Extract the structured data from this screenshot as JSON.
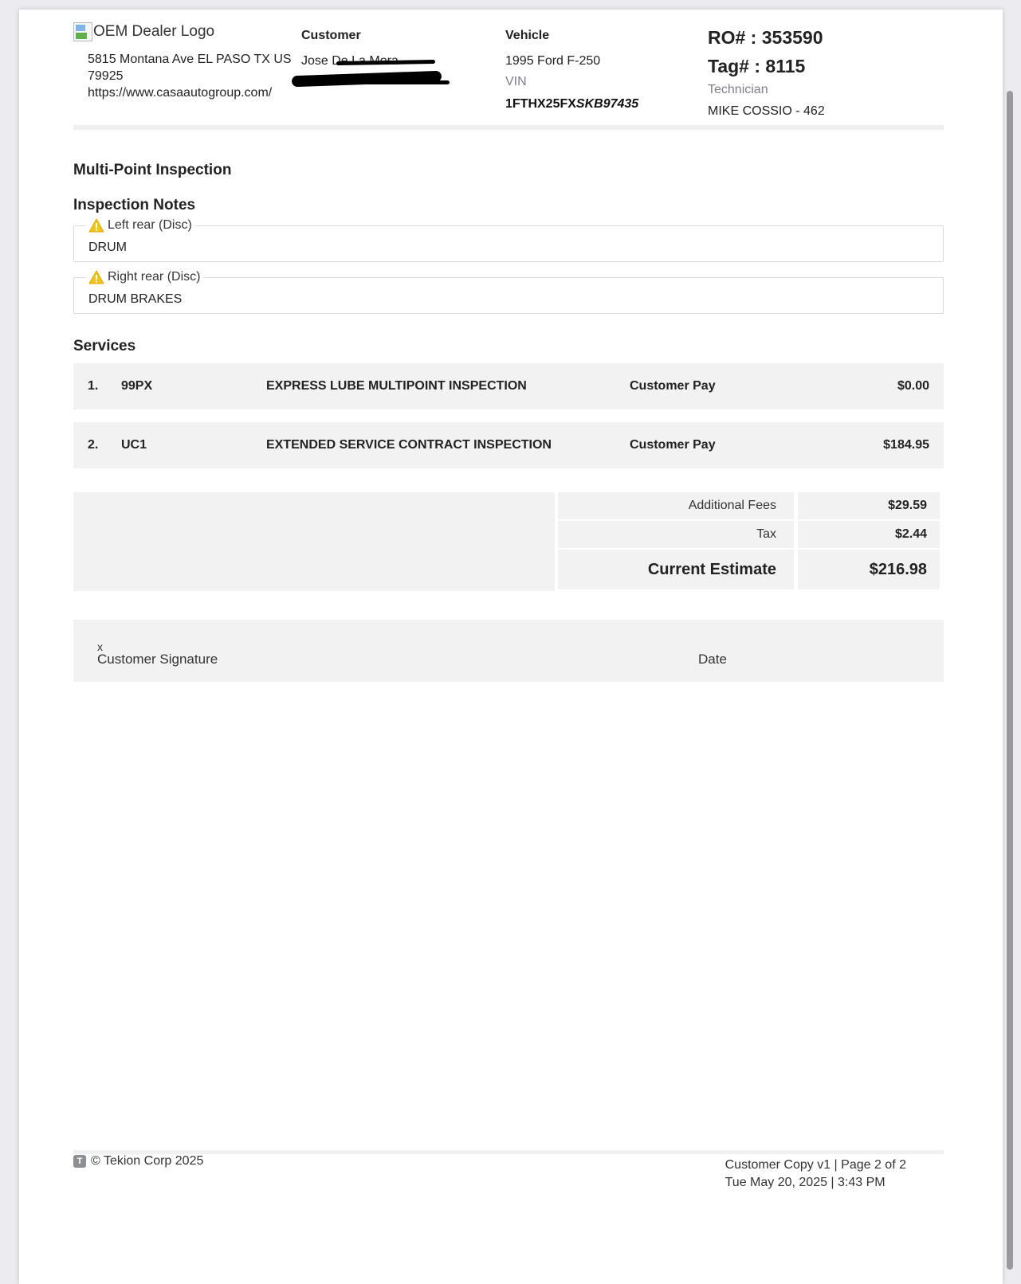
{
  "header": {
    "logo_alt": "OEM Dealer Logo",
    "dealer_address": "5815 Montana Ave EL PASO TX US 79925",
    "dealer_url": "https://www.casaautogroup.com/",
    "customer_label": "Customer",
    "customer_name": "Jose De La Mora",
    "vehicle_label": "Vehicle",
    "vehicle_desc": "1995 Ford F-250",
    "vin_label": "VIN",
    "vin_prefix": "1FTHX25FX",
    "vin_suffix": "SKB97435",
    "ro": "RO# : 353590",
    "tag": "Tag# : 8115",
    "technician_label": "Technician",
    "technician_name": "MIKE COSSIO - 462"
  },
  "mpi_title": "Multi-Point Inspection",
  "notes_title": "Inspection Notes",
  "notes": [
    {
      "label": "Left rear (Disc)",
      "value": "DRUM"
    },
    {
      "label": "Right rear (Disc)",
      "value": "DRUM BRAKES"
    }
  ],
  "services_title": "Services",
  "services": [
    {
      "num": "1.",
      "code": "99PX",
      "desc": "EXPRESS LUBE MULTIPOINT INSPECTION",
      "pay": "Customer Pay",
      "amount": "$0.00"
    },
    {
      "num": "2.",
      "code": "UC1",
      "desc": "EXTENDED SERVICE CONTRACT INSPECTION",
      "pay": "Customer Pay",
      "amount": "$184.95"
    }
  ],
  "totals": {
    "fees_label": "Additional Fees",
    "fees": "$29.59",
    "tax_label": "Tax",
    "tax": "$2.44",
    "estimate_label": "Current Estimate",
    "estimate": "$216.98"
  },
  "signature": {
    "x": "x",
    "label": "Customer Signature",
    "date_label": "Date"
  },
  "footer": {
    "copyright": "© Tekion Corp 2025",
    "copy_info": "Customer Copy v1 | Page 2 of 2",
    "datetime": "Tue May 20, 2025 | 3:43 PM"
  },
  "colors": {
    "warning": "#f0c419",
    "row_bg": "#f2f2f3"
  },
  "icons": {
    "warning": "warning-icon",
    "logo": "broken-image-icon",
    "brand": "tekion-logo-icon"
  }
}
